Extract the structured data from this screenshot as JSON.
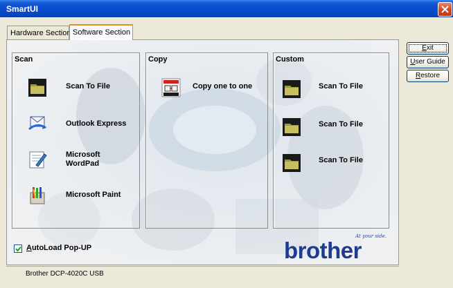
{
  "window": {
    "title": "SmartUI"
  },
  "tabs": [
    {
      "label": "Hardware Section",
      "active": false
    },
    {
      "label": "Software Section",
      "active": true
    }
  ],
  "scan": {
    "heading": "Scan",
    "items": [
      {
        "label": "Scan To File",
        "icon": "folder-icon"
      },
      {
        "label": "Outlook Express",
        "icon": "outlook-express-icon"
      },
      {
        "label_line1": "Microsoft",
        "label_line2": "WordPad",
        "icon": "wordpad-icon"
      },
      {
        "label": "Microsoft Paint",
        "icon": "paint-icon"
      }
    ]
  },
  "copy": {
    "heading": "Copy",
    "items": [
      {
        "label": "Copy one to one",
        "icon": "copy-icon"
      }
    ]
  },
  "custom": {
    "heading": "Custom",
    "items": [
      {
        "label": "Scan To File",
        "icon": "folder-icon"
      },
      {
        "label": "Scan To File",
        "icon": "folder-icon"
      },
      {
        "label": "Scan To File",
        "icon": "folder-icon"
      }
    ]
  },
  "autoload": {
    "label_first": "A",
    "label_rest": "utoLoad Pop-UP",
    "checked": true
  },
  "brand": {
    "word": "brother",
    "tagline": "At your side."
  },
  "buttons": {
    "exit_u": "E",
    "exit_rest": "xit",
    "guide_u": "U",
    "guide_rest": "ser Guide",
    "restore_u": "R",
    "restore_rest": "estore"
  },
  "status": {
    "device": "Brother DCP-4020C USB"
  },
  "colors": {
    "titlebar": "#0a4fd0",
    "brand": "#1f3c8c",
    "tab_highlight": "#e68b2c",
    "close": "#d64a24"
  }
}
